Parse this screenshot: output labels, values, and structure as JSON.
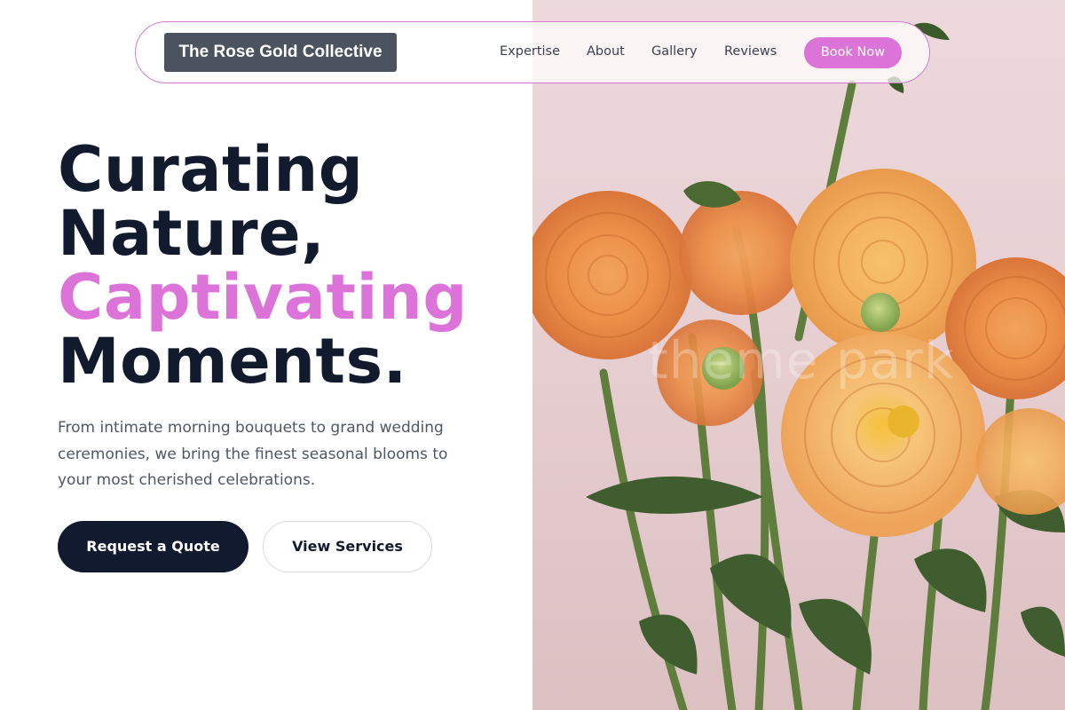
{
  "nav": {
    "brand": "The Rose Gold Collective",
    "links": [
      "Expertise",
      "About",
      "Gallery",
      "Reviews"
    ],
    "cta": "Book Now"
  },
  "hero": {
    "headline_line1": "Curating",
    "headline_line2": "Nature,",
    "headline_accent": "Captivating",
    "headline_line4": "Moments.",
    "subtext": "From intimate morning bouquets to grand wedding ceremonies, we bring the finest seasonal blooms to your most cherished celebrations.",
    "primary_button": "Request a Quote",
    "secondary_button": "View Services"
  },
  "image": {
    "watermark": "theme park",
    "subject": "orange-dahlias-bouquet"
  },
  "colors": {
    "accent": "#dc73d8",
    "dark": "#111a2e",
    "brand_bg": "#4b535f"
  }
}
